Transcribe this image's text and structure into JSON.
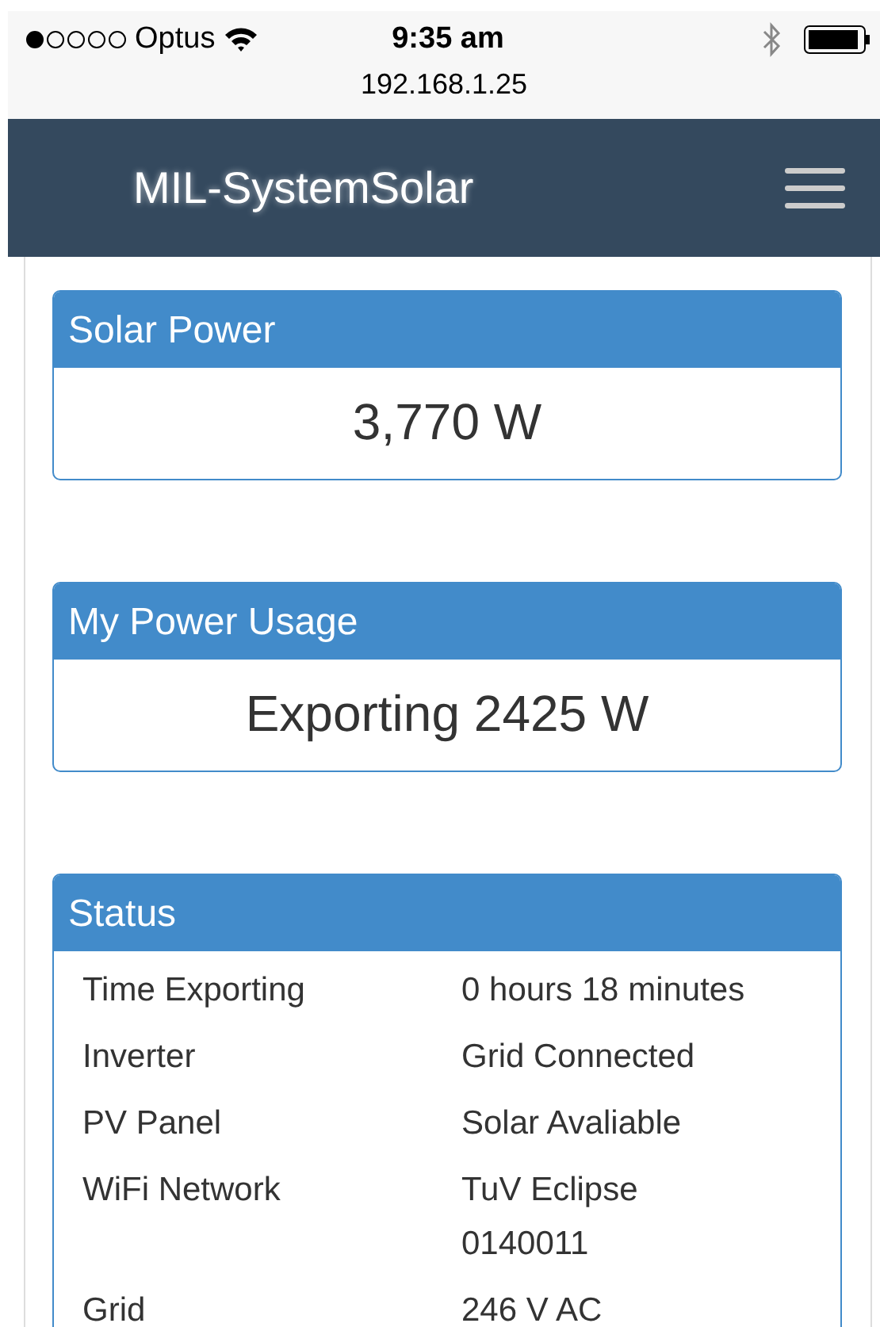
{
  "status_bar": {
    "carrier": "Optus",
    "time": "9:35 am",
    "address": "192.168.1.25"
  },
  "navbar": {
    "title": "MIL-SystemSolar"
  },
  "panels": [
    {
      "kind": "value",
      "title": "Solar Power",
      "value": "3,770 W"
    },
    {
      "kind": "value",
      "title": "My Power Usage",
      "value": "Exporting 2425 W"
    },
    {
      "kind": "table",
      "title": "Status",
      "rows": [
        {
          "label": "Time Exporting",
          "value": "0 hours 18 minutes"
        },
        {
          "label": "Inverter",
          "value": "Grid Connected"
        },
        {
          "label": "PV Panel",
          "value": "Solar Avaliable"
        },
        {
          "label": "WiFi Network",
          "value": "TuV Eclipse\n0140011"
        },
        {
          "label": "Grid",
          "value": "246 V AC"
        }
      ]
    }
  ]
}
